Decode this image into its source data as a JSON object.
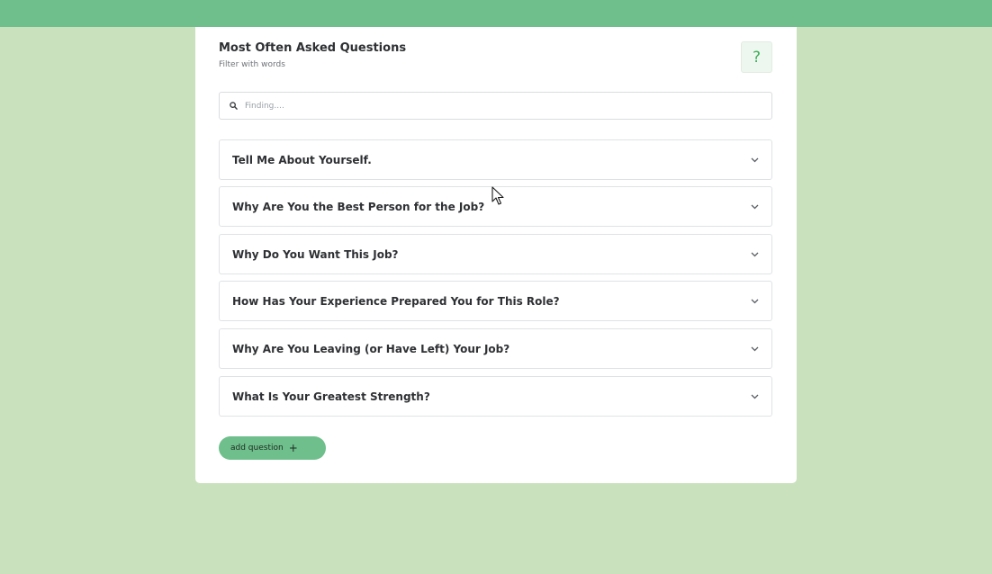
{
  "header": {
    "title": "Most Often Asked Questions",
    "subtitle": "Filter with words",
    "help_label": "?"
  },
  "search": {
    "placeholder": "Finding....",
    "value": "",
    "icon": "search-icon"
  },
  "faq_items": [
    {
      "question": "Tell Me About Yourself."
    },
    {
      "question": "Why Are You the Best Person for the Job?"
    },
    {
      "question": "Why Do You Want This Job?"
    },
    {
      "question": "How Has Your Experience Prepared You for This Role?"
    },
    {
      "question": "Why Are You Leaving (or Have Left) Your Job?"
    },
    {
      "question": "What Is Your Greatest Strength?"
    }
  ],
  "actions": {
    "add_label": "add question",
    "add_icon": "+"
  },
  "colors": {
    "accent": "#6ebf8b",
    "background": "#cae1bd",
    "card": "#ffffff",
    "help_icon": "#3cae59"
  }
}
